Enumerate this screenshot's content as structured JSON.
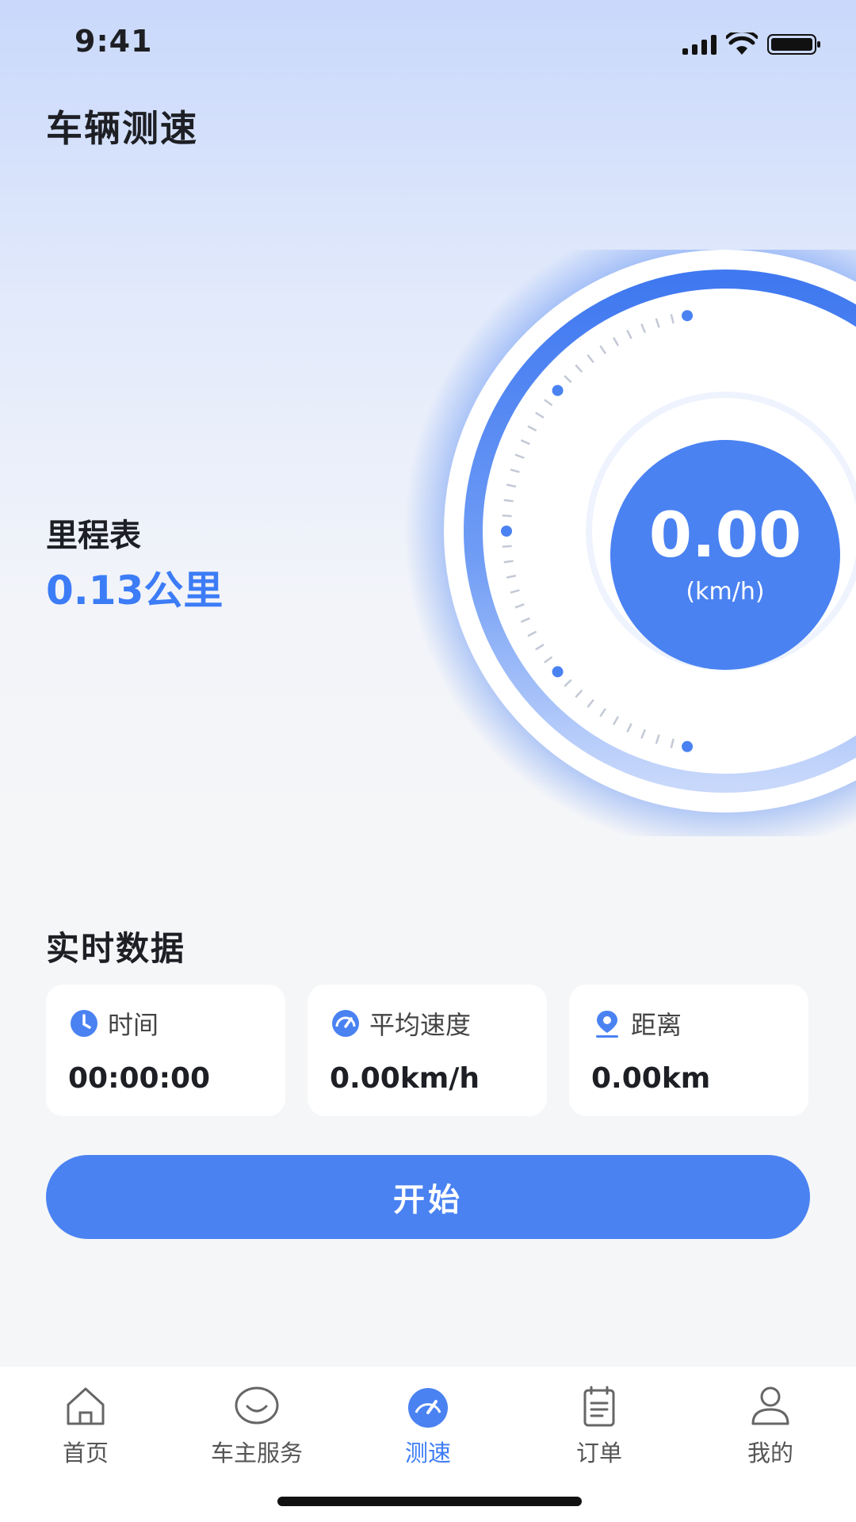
{
  "status_bar": {
    "time": "9:41"
  },
  "header": {
    "title": "车辆测速"
  },
  "odometer": {
    "label": "里程表",
    "value": "0.13公里"
  },
  "gauge": {
    "speed": "0.00",
    "unit": "(km/h)"
  },
  "realtime": {
    "title": "实时数据",
    "cards": [
      {
        "icon": "clock-icon",
        "label": "时间",
        "value": "00:00:00"
      },
      {
        "icon": "speedometer-icon",
        "label": "平均速度",
        "value": "0.00km/h"
      },
      {
        "icon": "location-pin-icon",
        "label": "距离",
        "value": "0.00km"
      }
    ]
  },
  "actions": {
    "start_label": "开始"
  },
  "tab_bar": {
    "items": [
      {
        "icon": "home-icon",
        "label": "首页"
      },
      {
        "icon": "chat-bubble-icon",
        "label": "车主服务"
      },
      {
        "icon": "speedometer-icon",
        "label": "测速"
      },
      {
        "icon": "order-icon",
        "label": "订单"
      },
      {
        "icon": "user-icon",
        "label": "我的"
      }
    ]
  },
  "colors": {
    "accent": "#4a82f2",
    "accent_text": "#3c7cf6"
  }
}
